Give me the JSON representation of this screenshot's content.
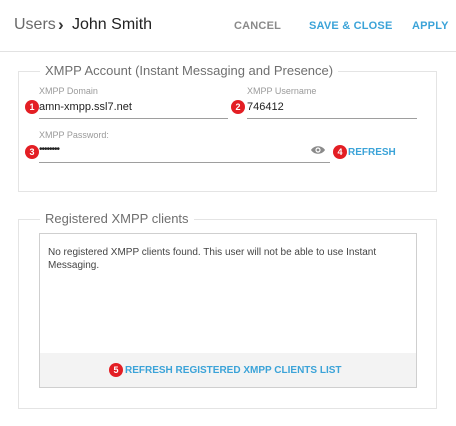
{
  "header": {
    "breadcrumb_root": "Users",
    "breadcrumb_separator": "›",
    "breadcrumb_current": "John Smith",
    "cancel_label": "CANCEL",
    "save_close_label": "SAVE & CLOSE",
    "apply_label": "APPLY"
  },
  "xmpp_account": {
    "legend": "XMPP Account (Instant Messaging and Presence)",
    "domain_label": "XMPP Domain",
    "domain_value": "amn-xmpp.ssl7.net",
    "username_label": "XMPP Username",
    "username_value": "746412",
    "password_label": "XMPP Password:",
    "password_value": "••••••••",
    "refresh_label": "REFRESH",
    "password_toggle_icon": "eye-icon"
  },
  "registered_clients": {
    "legend": "Registered XMPP clients",
    "message": "No registered XMPP clients found. This user will not be able to use Instant Messaging.",
    "refresh_list_label": "REFRESH REGISTERED XMPP CLIENTS LIST"
  },
  "badges": {
    "b1": "1",
    "b2": "2",
    "b3": "3",
    "b4": "4",
    "b5": "5"
  },
  "colors": {
    "accent": "#3ba3d8",
    "badge": "#e31e24"
  }
}
